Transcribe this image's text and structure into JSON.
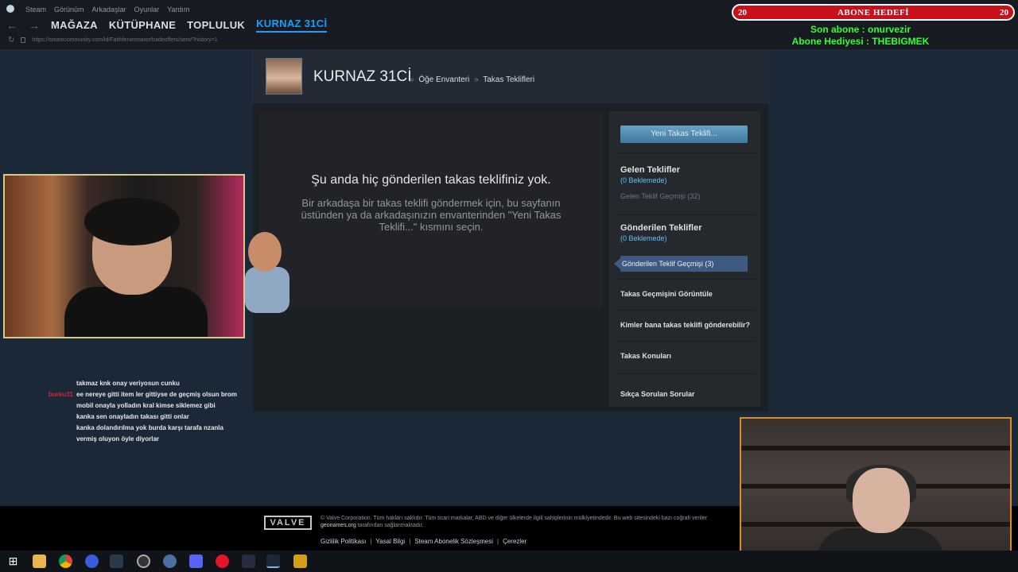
{
  "steam_menu": [
    "Steam",
    "Görünüm",
    "Arkadaşlar",
    "Oyunlar",
    "Yardım"
  ],
  "nav": {
    "store": "MAĞAZA",
    "library": "KÜTÜPHANE",
    "community": "TOPLULUK",
    "profile": "KURNAZ 31Cİ"
  },
  "url": "https://steamcommunity.com/id/Fatihfenimmator/tradeoffers/sent/?history=1",
  "overlay": {
    "goal_left": "20",
    "goal_title": "ABONE HEDEFİ",
    "goal_right": "20",
    "last_sub": "Son abone : onurvezir",
    "gift": "Abone Hediyesi : THEBIGMEK"
  },
  "profile": {
    "name": "KURNAZ 31Cİ",
    "crumb_inventory": "Öğe Envanteri",
    "crumb_sep": "»",
    "crumb_offers": "Takas Teklifleri"
  },
  "empty": {
    "title": "Şu anda hiç gönderilen takas teklifiniz yok.",
    "desc": "Bir arkadaşa bir takas teklifi göndermek için, bu sayfanın üstünden ya da arkadaşınızın envanterinden \"Yeni Takas Teklifi...\" kısmını seçin."
  },
  "sidebar": {
    "new_offer": "Yeni Takas Teklifi...",
    "incoming_title": "Gelen Teklifler",
    "incoming_pending": "(0 Beklemede)",
    "incoming_history": "Gelen Teklif Geçmişi (32)",
    "sent_title": "Gönderilen Teklifler",
    "sent_pending": "(0 Beklemede)",
    "sent_history": "Gönderilen Teklif Geçmişi (3)",
    "trade_history": "Takas Geçmişini Görüntüle",
    "who_can_send": "Kimler bana takas teklifi gönderebilir?",
    "trade_topics": "Takas Konuları",
    "faq": "Sıkça Sorulan Sorular"
  },
  "chat": [
    {
      "user": "",
      "msg": "takmaz knk onay veriyosun cunku",
      "color": "#d0263a"
    },
    {
      "user": "burku31",
      "msg": "ee nereye gitti item ler gittiyse de geçmiş olsun brom",
      "color": "#d0263a"
    },
    {
      "user": "",
      "msg": "mobil onayla yolladın kral kimse siklemez gibi",
      "color": "#a3233a"
    },
    {
      "user": "",
      "msg": "kanka sen onayladın takası gitti onlar",
      "color": "#c52020"
    },
    {
      "user": "",
      "msg": "kanka dolandırılma yok burda karşı tarafa nzanla vermiş oluyon öyle diyorlar",
      "color": "#1a2cc0"
    }
  ],
  "footer": {
    "logo": "VALVE",
    "copyright": "© Valve Corporation. Tüm hakları saklıdır. Tüm ticari markalar, ABD ve diğer ülkelerde ilgili sahiplerinin mülkiyetindedir. Bu web sitesindeki bazı coğrafi veriler",
    "geonames": "geonames.org",
    "copyright_tail": "tarafından sağlanmaktadır.",
    "links": [
      "Gizlilik Politikası",
      "Yasal Bilgi",
      "Steam Abonelik Sözleşmesi",
      "Çerezler"
    ]
  },
  "taskbar_icons": [
    "windows-icon",
    "file-explorer-icon",
    "chrome-icon",
    "browser-icon",
    "app-icon",
    "obs-icon",
    "app-round-icon",
    "discord-icon",
    "opera-icon",
    "app-ae-icon",
    "steam-icon",
    "app-k-icon"
  ]
}
